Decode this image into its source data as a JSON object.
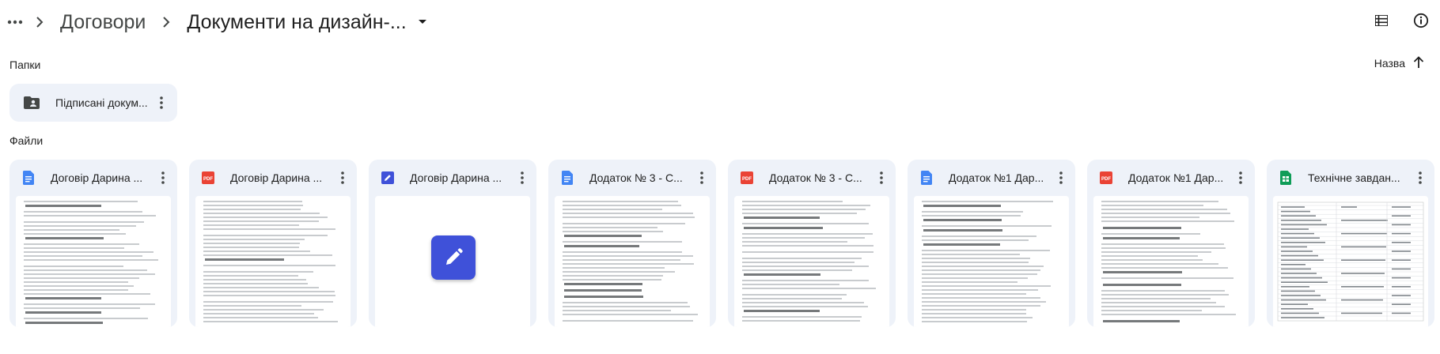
{
  "breadcrumb": {
    "parent": "Договори",
    "current": "Документи на дизайн-..."
  },
  "sections": {
    "folders_label": "Папки",
    "files_label": "Файли"
  },
  "sort": {
    "label": "Назва",
    "direction": "ascending"
  },
  "folders": [
    {
      "name": "Підписані докум...",
      "icon": "shared-folder-icon"
    }
  ],
  "files": [
    {
      "name": "Договір Дарина ...",
      "type": "google-docs",
      "icon": "google-docs-icon",
      "color": "#4285f4",
      "thumb": "doc"
    },
    {
      "name": "Договір Дарина ...",
      "type": "pdf",
      "icon": "pdf-icon",
      "color": "#ea4335",
      "thumb": "doc"
    },
    {
      "name": "Договір Дарина ...",
      "type": "drawing",
      "icon": "drawing-icon",
      "color": "#3f51d9",
      "thumb": "drawing"
    },
    {
      "name": "Додаток № 3 - С...",
      "type": "google-docs",
      "icon": "google-docs-icon",
      "color": "#4285f4",
      "thumb": "doc"
    },
    {
      "name": "Додаток № 3 - С...",
      "type": "pdf",
      "icon": "pdf-icon",
      "color": "#ea4335",
      "thumb": "doc"
    },
    {
      "name": "Додаток №1 Дар...",
      "type": "google-docs",
      "icon": "google-docs-icon",
      "color": "#4285f4",
      "thumb": "doc"
    },
    {
      "name": "Додаток №1 Дар...",
      "type": "pdf",
      "icon": "pdf-icon",
      "color": "#ea4335",
      "thumb": "doc"
    },
    {
      "name": "Технічне завдан...",
      "type": "google-sheets",
      "icon": "google-sheets-icon",
      "color": "#0f9d58",
      "thumb": "sheet"
    }
  ],
  "icons": {
    "more": "more-horizontal-icon",
    "separator": "chevron-right-icon",
    "dropdown": "caret-down-icon",
    "list_view": "list-view-icon",
    "info": "info-icon",
    "sort_arrow": "arrow-up-icon",
    "menu": "more-vertical-icon"
  }
}
